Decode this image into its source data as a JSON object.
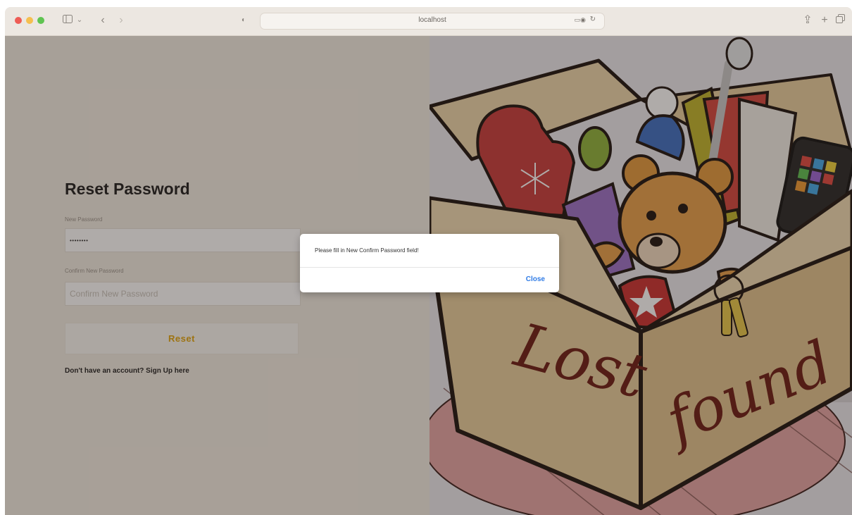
{
  "browser": {
    "url": "localhost"
  },
  "form": {
    "title": "Reset Password",
    "new_password_label": "New Password",
    "new_password_value": "••••••••",
    "confirm_label": "Confirm New Password",
    "confirm_placeholder": "Confirm New Password",
    "reset_label": "Reset",
    "signup_text": "Don't have an account? Sign Up here"
  },
  "illustration": {
    "box_words": [
      "Lost",
      "found"
    ]
  },
  "dialog": {
    "message": "Please fill in New Confirm Password field!",
    "close_label": "Close"
  },
  "colors": {
    "accent": "#e3a50b",
    "link": "#2f7be6",
    "box_text": "#6b1a12"
  }
}
